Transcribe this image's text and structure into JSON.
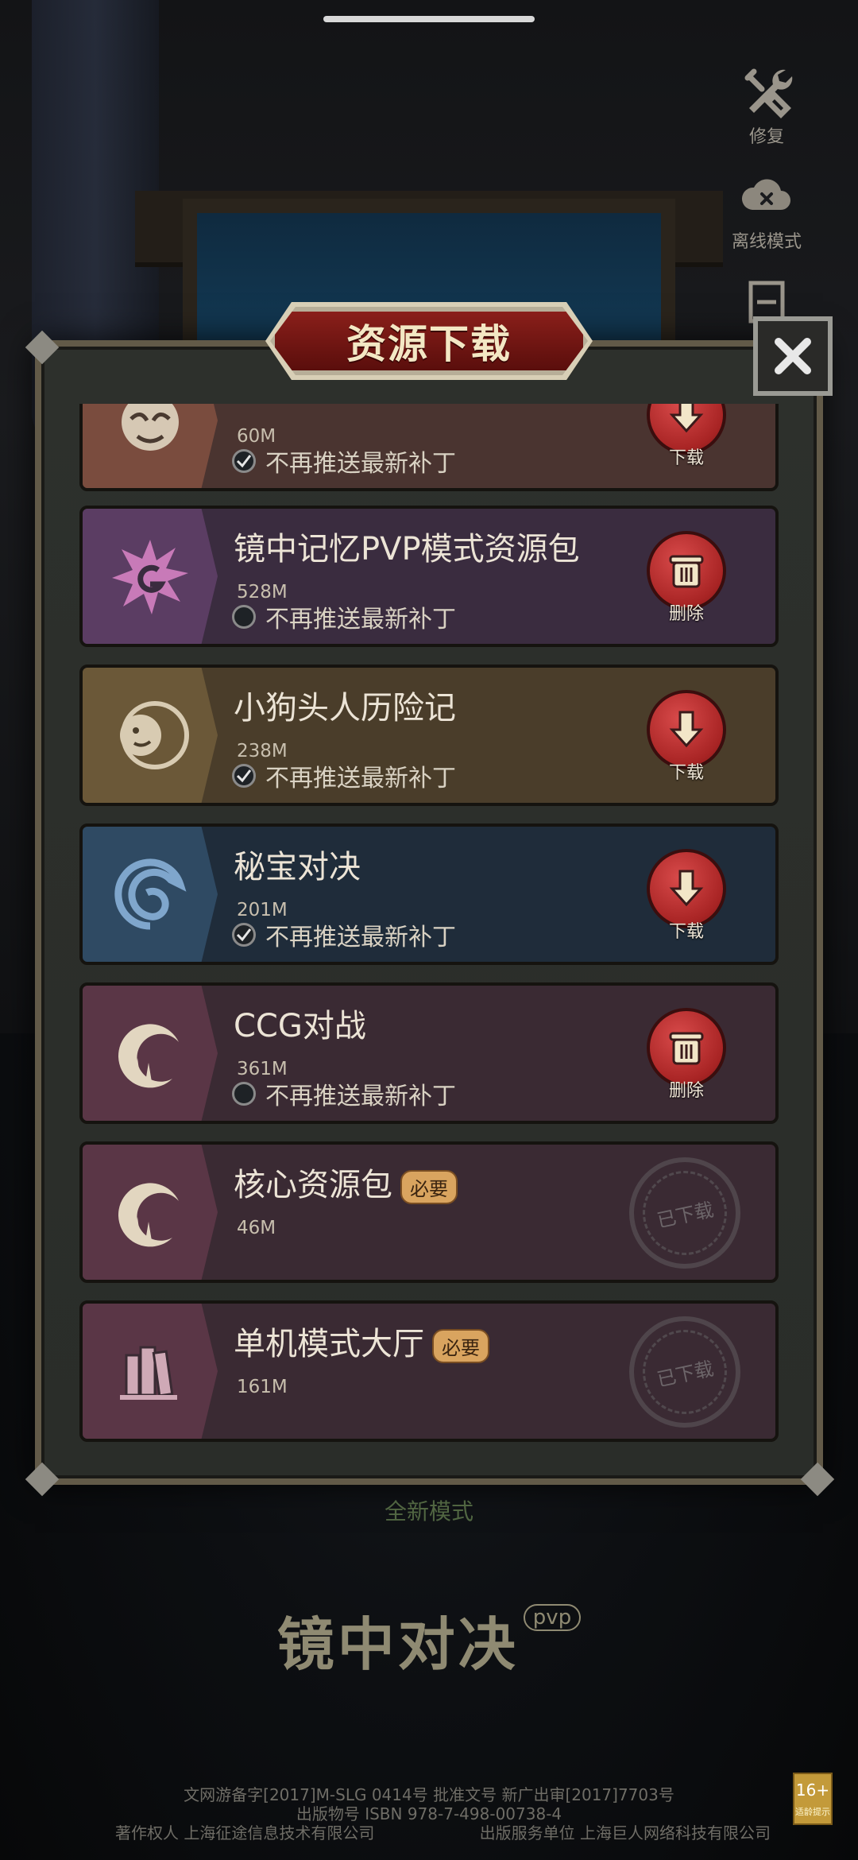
{
  "side_buttons": [
    {
      "label": "修复",
      "icon": "wrench-screwdriver-icon"
    },
    {
      "label": "离线模式",
      "icon": "cloud-offline-icon"
    }
  ],
  "modal": {
    "title": "资源下载",
    "close_icon": "close-icon"
  },
  "resources": [
    {
      "name": "",
      "size": "60M",
      "push_label": "不再推送最新补丁",
      "push_checked": true,
      "action": "下载",
      "action_icon": "download-arrow-icon",
      "emblem": "dark-mask-icon",
      "theme": "#5a3a33",
      "emblem_bg": "#7a4c3e"
    },
    {
      "name": "镜中记忆PVP模式资源包",
      "size": "528M",
      "push_label": "不再推送最新补丁",
      "push_checked": false,
      "action": "删除",
      "action_icon": "trash-icon",
      "emblem": "spiky-swirl-icon",
      "theme": "#3a2c3f",
      "emblem_bg": "#5b3d63"
    },
    {
      "name": "小狗头人历险记",
      "size": "238M",
      "push_label": "不再推送最新补丁",
      "push_checked": true,
      "action": "下载",
      "action_icon": "download-arrow-icon",
      "emblem": "kobold-face-icon",
      "theme": "#4a3d2a",
      "emblem_bg": "#6b5838"
    },
    {
      "name": "秘宝对决",
      "size": "201M",
      "push_label": "不再推送最新补丁",
      "push_checked": true,
      "action": "下载",
      "action_icon": "download-arrow-icon",
      "emblem": "blue-swirl-icon",
      "theme": "#1f2c3a",
      "emblem_bg": "#2f4a63"
    },
    {
      "name": "CCG对战",
      "size": "361M",
      "push_label": "不再推送最新补丁",
      "push_checked": false,
      "action": "删除",
      "action_icon": "trash-icon",
      "emblem": "crescent-tree-icon",
      "theme": "#3a2a33",
      "emblem_bg": "#5a3646"
    },
    {
      "name": "核心资源包",
      "tag": "必要",
      "size": "46M",
      "stamp": "已下载",
      "emblem": "crescent-tree-icon",
      "theme": "#3a2a33",
      "emblem_bg": "#5a3646"
    },
    {
      "name": "单机模式大厅",
      "tag": "必要",
      "size": "161M",
      "stamp": "已下载",
      "emblem": "books-icon",
      "theme": "#3a2a33",
      "emblem_bg": "#5a3646"
    }
  ],
  "below_label": "全新模式",
  "game_logo": {
    "text": "镜中对决",
    "badge": "pvp"
  },
  "footer": {
    "line1": "文网游备字[2017]M-SLG 0414号 批准文号 新广出审[2017]7703号",
    "line2": "出版物号 ISBN 978-7-498-00738-4",
    "line3_left": "著作权人 上海征途信息技术有限公司",
    "line3_right": "出版服务单位 上海巨人网络科技有限公司"
  },
  "age_badge": {
    "rating": "16+",
    "label": "适龄提示"
  }
}
